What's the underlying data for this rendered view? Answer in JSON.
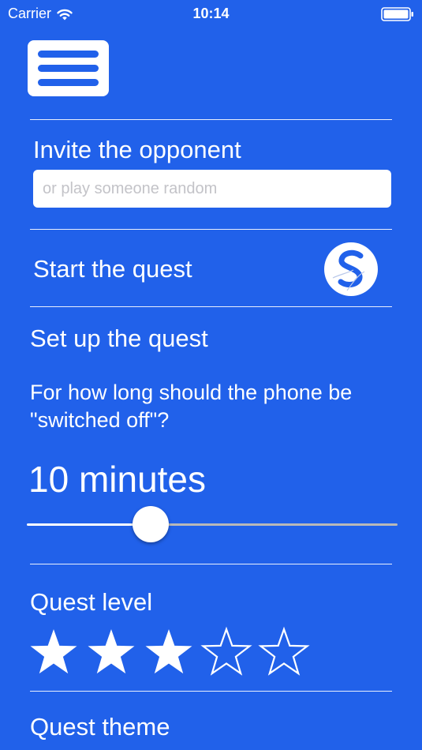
{
  "status_bar": {
    "carrier": "Carrier",
    "time": "10:14",
    "icons": [
      "wifi-icon",
      "battery-icon"
    ]
  },
  "menu": {
    "icon": "hamburger-menu-icon"
  },
  "invite": {
    "label": "Invite the opponent",
    "placeholder": "or play someone random",
    "value": ""
  },
  "start": {
    "label": "Start the quest",
    "icon": "skype-icon"
  },
  "setup": {
    "heading": "Set up the quest",
    "question": "For how long should the phone be \"switched off\"?",
    "duration_label": "10 minutes",
    "slider_fraction": 0.33
  },
  "level": {
    "label": "Quest level",
    "filled_stars": 3,
    "total_stars": 5
  },
  "theme": {
    "label": "Quest theme"
  },
  "colors": {
    "background": "#2161ea",
    "foreground": "#ffffff",
    "slider_inactive": "#b8b8b8"
  }
}
